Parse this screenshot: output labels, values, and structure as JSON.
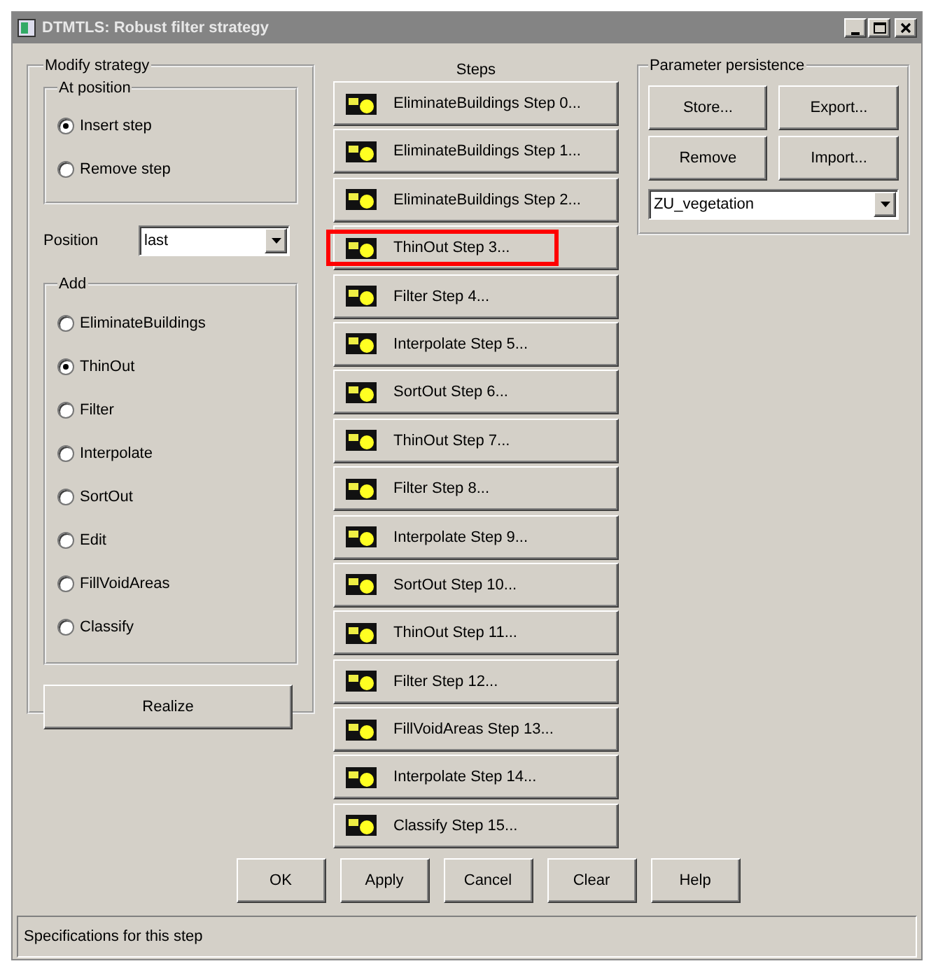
{
  "window": {
    "title": "DTMTLS: Robust filter strategy"
  },
  "modify_strategy": {
    "title": "Modify strategy",
    "at_position": {
      "title": "At position",
      "options": [
        {
          "label": "Insert step",
          "selected": true
        },
        {
          "label": "Remove step",
          "selected": false
        }
      ]
    },
    "position": {
      "label": "Position",
      "value": "last"
    },
    "add": {
      "title": "Add",
      "options": [
        {
          "label": "EliminateBuildings",
          "selected": false
        },
        {
          "label": "ThinOut",
          "selected": true
        },
        {
          "label": "Filter",
          "selected": false
        },
        {
          "label": "Interpolate",
          "selected": false
        },
        {
          "label": "SortOut",
          "selected": false
        },
        {
          "label": "Edit",
          "selected": false
        },
        {
          "label": "FillVoidAreas",
          "selected": false
        },
        {
          "label": "Classify",
          "selected": false
        }
      ]
    },
    "realize_button": "Realize"
  },
  "steps": {
    "title": "Steps",
    "items": [
      {
        "label": "EliminateBuildings Step 0...",
        "highlighted": false
      },
      {
        "label": "EliminateBuildings Step 1...",
        "highlighted": false
      },
      {
        "label": "EliminateBuildings Step 2...",
        "highlighted": false
      },
      {
        "label": "ThinOut Step 3...",
        "highlighted": true
      },
      {
        "label": "Filter Step 4...",
        "highlighted": false
      },
      {
        "label": "Interpolate Step 5...",
        "highlighted": false
      },
      {
        "label": "SortOut Step 6...",
        "highlighted": false
      },
      {
        "label": "ThinOut Step 7...",
        "highlighted": false
      },
      {
        "label": "Filter Step 8...",
        "highlighted": false
      },
      {
        "label": "Interpolate Step 9...",
        "highlighted": false
      },
      {
        "label": "SortOut Step 10...",
        "highlighted": false
      },
      {
        "label": "ThinOut Step 11...",
        "highlighted": false
      },
      {
        "label": "Filter Step 12...",
        "highlighted": false
      },
      {
        "label": "FillVoidAreas Step 13...",
        "highlighted": false
      },
      {
        "label": "Interpolate Step 14...",
        "highlighted": false
      },
      {
        "label": "Classify Step 15...",
        "highlighted": false
      }
    ]
  },
  "parameter_persistence": {
    "title": "Parameter persistence",
    "buttons": [
      "Store...",
      "Export...",
      "Remove",
      "Import..."
    ],
    "preset": {
      "value": "ZU_vegetation"
    }
  },
  "buttons": [
    "OK",
    "Apply",
    "Cancel",
    "Clear",
    "Help"
  ],
  "status_bar": "Specifications for this step"
}
